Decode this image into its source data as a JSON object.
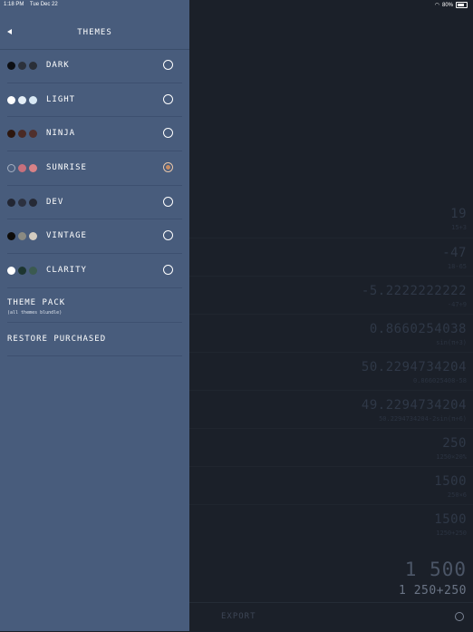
{
  "status": {
    "time": "1:18 PM",
    "date": "Tue Dec 22",
    "battery": "80%"
  },
  "sidebar": {
    "title": "THEMES",
    "themes": [
      {
        "label": "DARK",
        "colors": [
          "#0d0f14",
          "#2c313b",
          "#2a2f38"
        ],
        "selected": false
      },
      {
        "label": "LIGHT",
        "colors": [
          "#ffffff",
          "#e4eef6",
          "#d8e8f4"
        ],
        "selected": false
      },
      {
        "label": "NINJA",
        "colors": [
          "#2d170f",
          "#4a2a25",
          "#50302d"
        ],
        "selected": false
      },
      {
        "label": "SUNRISE",
        "colors": [
          "#4c5f7f",
          "#c7707d",
          "#d88287"
        ],
        "selected": true
      },
      {
        "label": "DEV",
        "colors": [
          "#222633",
          "#2c3140",
          "#262a36"
        ],
        "selected": false
      },
      {
        "label": "VINTAGE",
        "colors": [
          "#0e0c0a",
          "#8a8a82",
          "#d4ccc0"
        ],
        "selected": false
      },
      {
        "label": "CLARITY",
        "colors": [
          "#ffffff",
          "#1d3530",
          "#3b5a50"
        ],
        "selected": false
      }
    ],
    "theme_pack": {
      "label": "THEME PACK",
      "sub": "(all themes blundle)"
    },
    "restore": {
      "label": "RESTORE PURCHASED"
    }
  },
  "calc": {
    "history": [
      {
        "result": "19",
        "expr": "15+3"
      },
      {
        "result": "-47",
        "expr": "18-65"
      },
      {
        "result": "-5.2222222222",
        "expr": "-47÷9"
      },
      {
        "result": "0.8660254038",
        "expr": "sin(π÷3)"
      },
      {
        "result": "50.2294734204",
        "expr": "0.866025408-58"
      },
      {
        "result": "49.2294734204",
        "expr": "50.2294734204-2sin(π÷6)"
      },
      {
        "result": "250",
        "expr": "1250×20%"
      },
      {
        "result": "1500",
        "expr": "250×6"
      },
      {
        "result": "1500",
        "expr": "1250+250"
      }
    ],
    "main_result": "1 500",
    "main_expr": "1 250+250",
    "export_label": "EXPORT"
  }
}
